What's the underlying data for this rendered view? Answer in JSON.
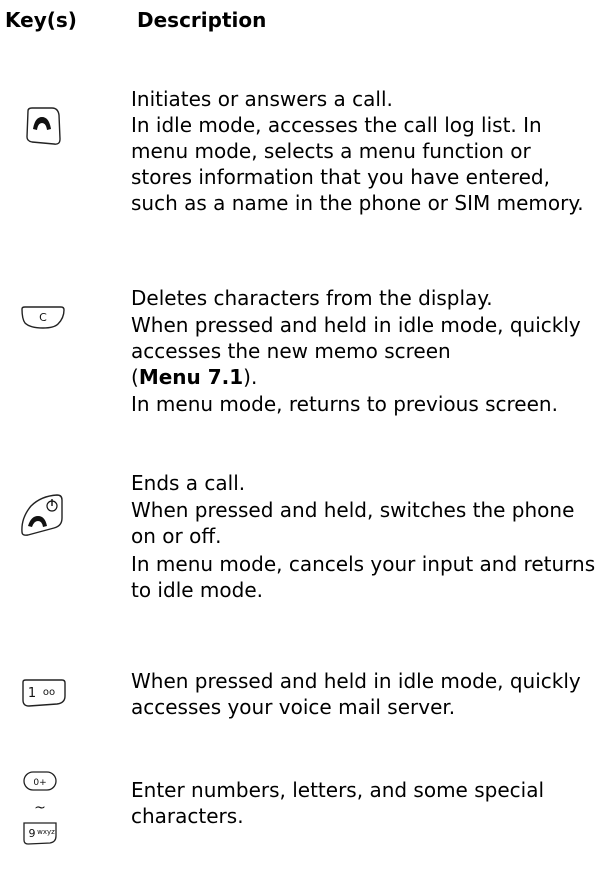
{
  "header": {
    "key_label": "Key(s)",
    "description_label": "Description"
  },
  "rows": [
    {
      "icon": "send-key-icon",
      "lines": [
        "Initiates or answers a call.",
        "In idle mode, accesses the call log list. In menu mode, selects a menu function or stores information that you have entered, such as a name in the phone or SIM memory."
      ]
    },
    {
      "icon": "clear-key-icon",
      "lines": [
        "Deletes characters from the display.",
        "When pressed and held in idle mode, quickly accesses the new memo screen",
        "(",
        "Menu 7.1",
        ").",
        "In menu mode, returns to previous screen."
      ]
    },
    {
      "icon": "end-power-key-icon",
      "lines": [
        "Ends a call.",
        "When pressed and held, switches the phone on or off.",
        "In menu mode, cancels your input and returns to idle mode."
      ]
    },
    {
      "icon": "voicemail-key-icon",
      "lines": [
        "When pressed and held in idle mode, quickly accesses your voice mail server."
      ]
    },
    {
      "icon": "number-keys-icon",
      "lines": [
        "Enter numbers, letters, and some special characters."
      ]
    }
  ],
  "icon_glyphs": {
    "clear": "C",
    "voicemail_digit": "1",
    "voicemail_symbol": "oo",
    "zero_key": "0+",
    "range": "~",
    "nine_key": "9",
    "nine_letters": "wxyz"
  }
}
